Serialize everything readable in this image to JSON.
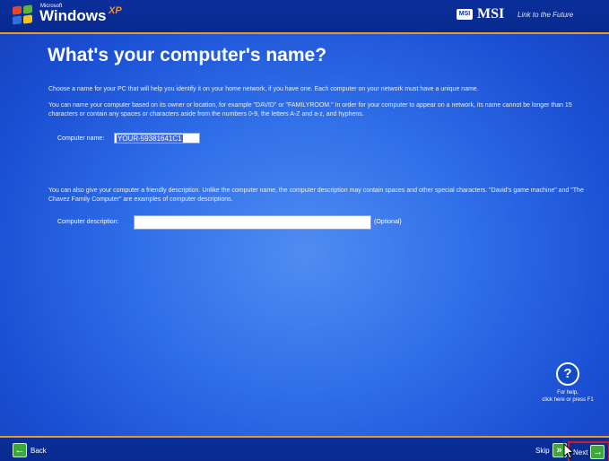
{
  "window": {
    "brand_microsoft": "Microsoft",
    "brand_windows": "Windows",
    "brand_xp": "XP",
    "msi_badge": "MSI",
    "msi_logo": "MSI",
    "msi_tagline": "Link to the Future"
  },
  "page": {
    "title": "What's your computer's name?",
    "intro": "Choose a name for your PC that will help you identify it on your home network, if you have one. Each computer on your network must have a unique name.",
    "rules": "You can name your computer based on its owner or location, for example \"DAVID\" or \"FAMILYROOM.\" In order for your computer to appear on a network, its name cannot be longer than 15 characters or contain any spaces or characters aside from the numbers 0-9, the letters A-Z and a-z, and hyphens.",
    "computer_name_label": "Computer name:",
    "computer_name_value": "YOUR-59381641C1",
    "description_intro": "You can also give your computer a friendly description. Unlike the computer name, the computer description may contain spaces and other special characters. \"David's game machine\" and \"The Chavez Family Computer\" are examples of computer descriptions.",
    "computer_description_label": "Computer description:",
    "computer_description_value": "",
    "optional_label": "(Optional)"
  },
  "help": {
    "icon_glyph": "?",
    "line1": "For help,",
    "line2": "click here or press F1"
  },
  "footer": {
    "back_label": "Back",
    "skip_label": "Skip",
    "next_label": "Next",
    "back_icon_glyph": "←",
    "skip_icon_glyph": "»",
    "next_icon_glyph": "→"
  },
  "colors": {
    "background": "#2f6ee8",
    "bar": "#0a2e9a",
    "accent_line": "#e79a2c",
    "button_green": "#3ea83b",
    "highlight_red": "#d21b1b"
  }
}
